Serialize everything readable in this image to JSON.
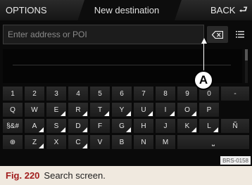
{
  "header": {
    "options_label": "OPTIONS",
    "title": "New destination",
    "back_label": "BACK",
    "back_icon": "return-arrow-icon"
  },
  "search": {
    "placeholder": "Enter address or POI",
    "backspace_icon": "backspace-icon",
    "list_icon": "list-icon"
  },
  "keyboard": {
    "rows": [
      [
        "1",
        "2",
        "3",
        "4",
        "5",
        "6",
        "7",
        "8",
        "9",
        "0",
        "-"
      ],
      [
        "Q",
        "W",
        "E",
        "R",
        "T",
        "Y",
        "U",
        "I",
        "O",
        "P"
      ],
      [
        "§&#",
        "A",
        "S",
        "D",
        "F",
        "G",
        "H",
        "J",
        "K",
        "L",
        "Ñ"
      ],
      [
        "⊕",
        "Z",
        "X",
        "C",
        "V",
        "B",
        "N",
        "M",
        "⎵"
      ]
    ],
    "globe_icon": "globe-icon",
    "space_icon": "space-icon"
  },
  "callout": {
    "label": "A"
  },
  "image_code": "BRS-0158",
  "caption": {
    "figure": "Fig. 220",
    "text": "Search screen."
  },
  "colors": {
    "screen_bg": "#0a0a0a",
    "key_bg": "#242424",
    "caption_bg": "#f0e9df",
    "caption_accent": "#a11d1d"
  }
}
